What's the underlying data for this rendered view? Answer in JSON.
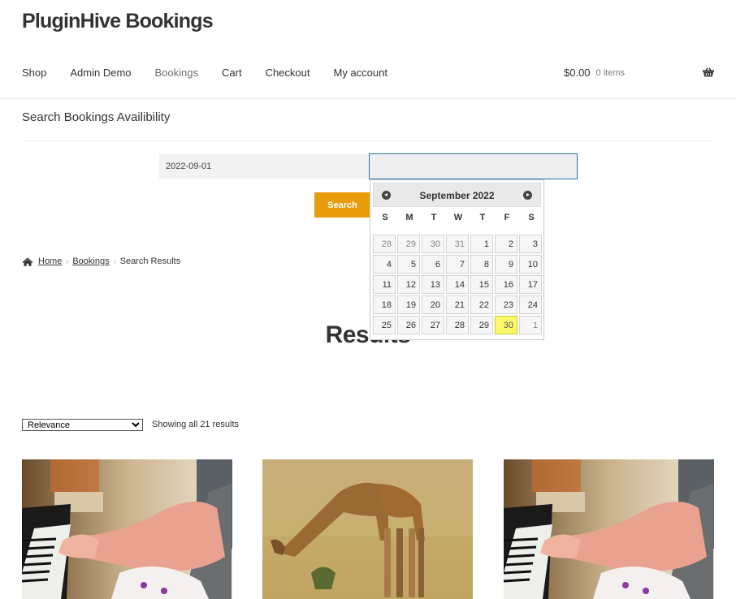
{
  "site": {
    "title": "PluginHive Bookings"
  },
  "nav": {
    "items": [
      {
        "label": "Shop"
      },
      {
        "label": "Admin Demo"
      },
      {
        "label": "Bookings",
        "current": true
      },
      {
        "label": "Cart"
      },
      {
        "label": "Checkout"
      },
      {
        "label": "My account"
      }
    ]
  },
  "cart": {
    "amount": "$0.00",
    "count": "0 items",
    "icon": "basket-icon"
  },
  "search": {
    "title": "Search Bookings Availibility",
    "start_date": "2022-09-01",
    "end_date": "",
    "button_label": "Search"
  },
  "datepicker": {
    "month_label": "September 2022",
    "prev_icon": "circle-triangle-left-icon",
    "next_icon": "circle-triangle-right-icon",
    "weekdays": [
      "S",
      "M",
      "T",
      "W",
      "T",
      "F",
      "S"
    ],
    "weeks": [
      [
        {
          "d": "28",
          "other": true
        },
        {
          "d": "29",
          "other": true
        },
        {
          "d": "30",
          "other": true
        },
        {
          "d": "31",
          "other": true
        },
        {
          "d": "1"
        },
        {
          "d": "2"
        },
        {
          "d": "3"
        }
      ],
      [
        {
          "d": "4"
        },
        {
          "d": "5"
        },
        {
          "d": "6"
        },
        {
          "d": "7"
        },
        {
          "d": "8"
        },
        {
          "d": "9"
        },
        {
          "d": "10"
        }
      ],
      [
        {
          "d": "11"
        },
        {
          "d": "12"
        },
        {
          "d": "13"
        },
        {
          "d": "14"
        },
        {
          "d": "15"
        },
        {
          "d": "16"
        },
        {
          "d": "17"
        }
      ],
      [
        {
          "d": "18"
        },
        {
          "d": "19"
        },
        {
          "d": "20"
        },
        {
          "d": "21"
        },
        {
          "d": "22"
        },
        {
          "d": "23"
        },
        {
          "d": "24"
        }
      ],
      [
        {
          "d": "25"
        },
        {
          "d": "26"
        },
        {
          "d": "27"
        },
        {
          "d": "28"
        },
        {
          "d": "29"
        },
        {
          "d": "30",
          "today": true
        },
        {
          "d": "1",
          "other": true
        }
      ]
    ]
  },
  "breadcrumb": {
    "home_icon": "home-icon",
    "items": [
      "Home",
      "Bookings"
    ],
    "current": "Search Results",
    "separator": "›"
  },
  "results": {
    "title": "Results",
    "sort_selected": "Relevance",
    "count_text": "Showing all 21 results"
  },
  "products": [
    {
      "image": "piano-child-photo"
    },
    {
      "image": "giraffe-photo"
    },
    {
      "image": "piano-child-photo"
    }
  ],
  "colors": {
    "accent": "#e89c0c",
    "today_highlight": "#fbf96a",
    "focus_border": "#2271b1"
  }
}
